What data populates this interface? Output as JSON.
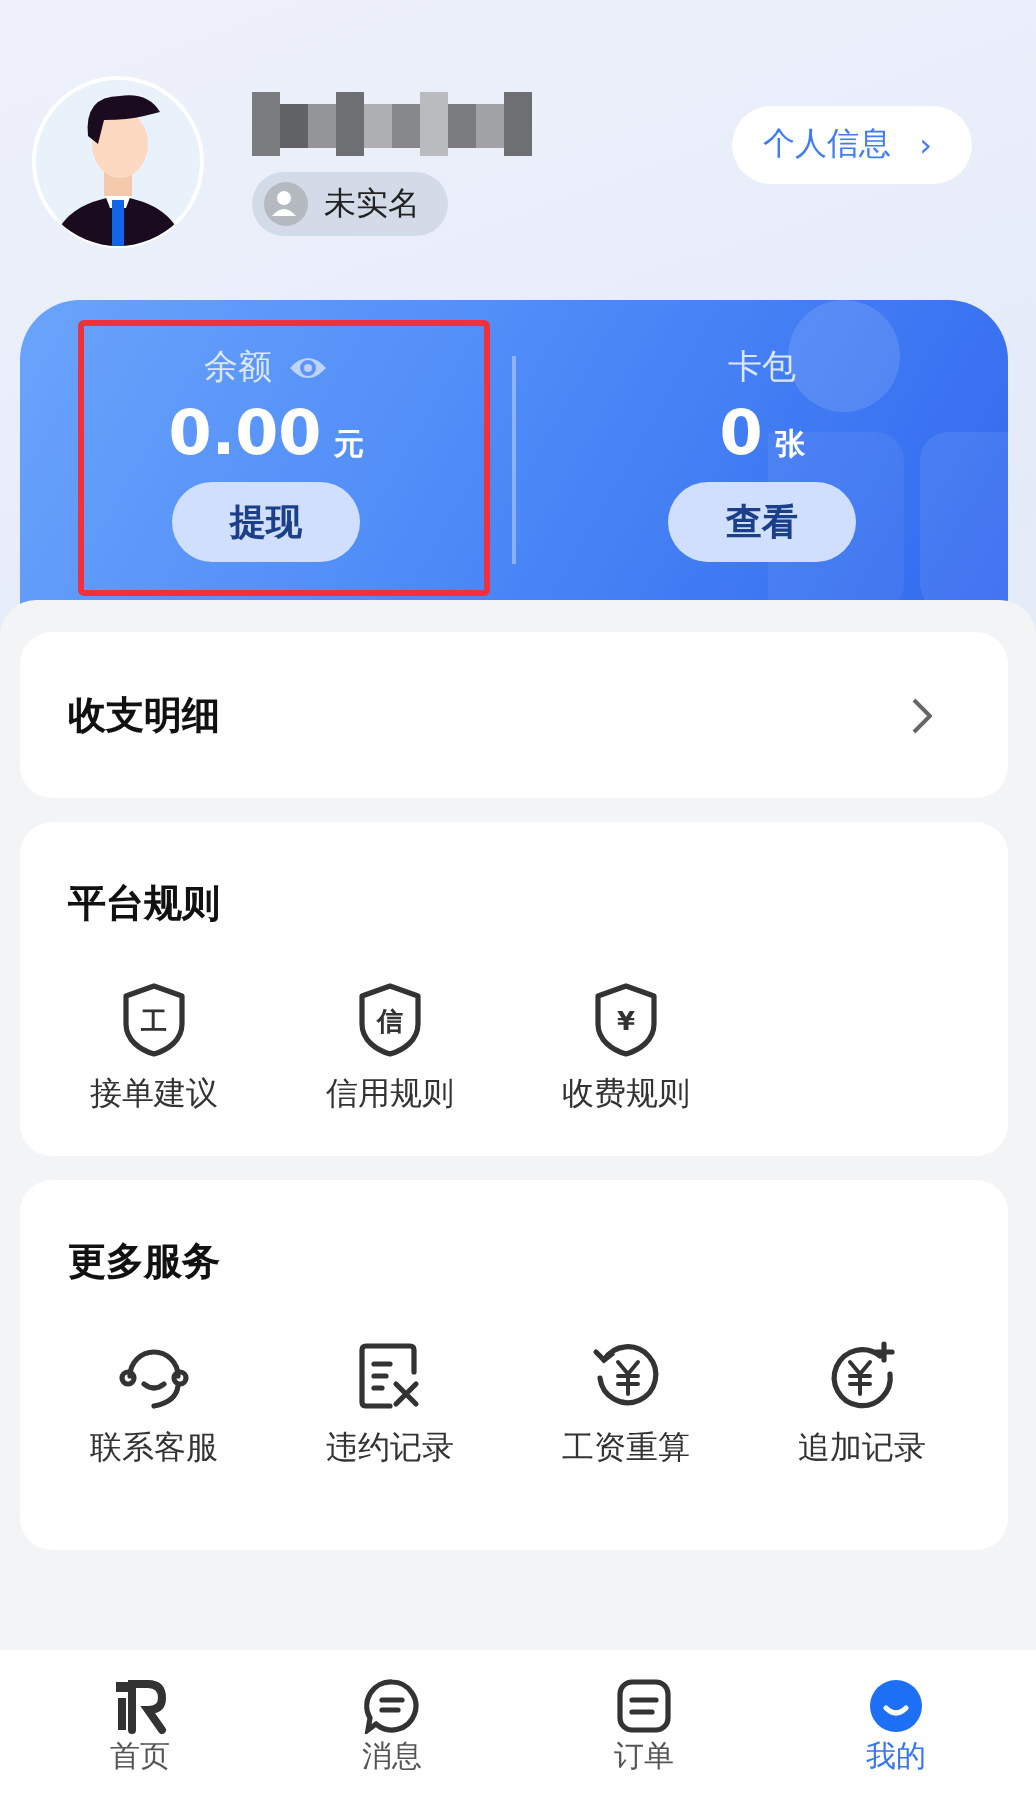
{
  "profile": {
    "verify_label": "未实名",
    "info_button": "个人信息",
    "info_arrow": "›"
  },
  "wallet": {
    "balance": {
      "label": "余额",
      "amount": "0.00",
      "unit": "元",
      "button": "提现",
      "highlighted": true
    },
    "cards": {
      "label": "卡包",
      "amount": "0",
      "unit": "张",
      "button": "查看"
    }
  },
  "statement": {
    "title": "收支明细"
  },
  "rules": {
    "title": "平台规则",
    "items": [
      {
        "label": "接单建议",
        "kind": "shield",
        "glyph": "工"
      },
      {
        "label": "信用规则",
        "kind": "shield",
        "glyph": "信"
      },
      {
        "label": "收费规则",
        "kind": "shield",
        "glyph": "¥"
      }
    ]
  },
  "services": {
    "title": "更多服务",
    "items": [
      {
        "label": "联系客服",
        "kind": "headset"
      },
      {
        "label": "违约记录",
        "kind": "doc-x"
      },
      {
        "label": "工资重算",
        "kind": "yen-refresh"
      },
      {
        "label": "追加记录",
        "kind": "yen-plus"
      }
    ]
  },
  "tabs": [
    {
      "label": "首页",
      "kind": "home",
      "selected": false
    },
    {
      "label": "消息",
      "kind": "chat",
      "selected": false
    },
    {
      "label": "订单",
      "kind": "order",
      "selected": false
    },
    {
      "label": "我的",
      "kind": "me",
      "selected": true
    }
  ]
}
